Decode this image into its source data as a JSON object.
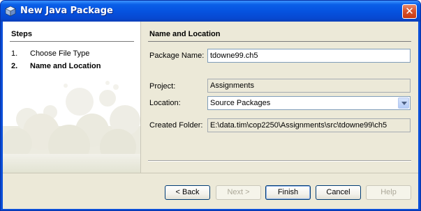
{
  "window": {
    "title": "New Java Package",
    "close_glyph": "✕"
  },
  "steps": {
    "title": "Steps",
    "items": [
      {
        "num": "1.",
        "label": "Choose File Type",
        "active": false
      },
      {
        "num": "2.",
        "label": "Name and Location",
        "active": true
      }
    ]
  },
  "form": {
    "title": "Name and Location",
    "package_name": {
      "label": "Package Name:",
      "value": "tdowne99.ch5"
    },
    "project": {
      "label": "Project:",
      "value": "Assignments"
    },
    "location": {
      "label": "Location:",
      "value": "Source Packages"
    },
    "created_folder": {
      "label": "Created Folder:",
      "value": "E:\\data.tim\\cop2250\\Assignments\\src\\tdowne99\\ch5"
    }
  },
  "buttons": {
    "back": "< Back",
    "next": "Next >",
    "finish": "Finish",
    "cancel": "Cancel",
    "help": "Help"
  },
  "colors": {
    "title_bar": "#0653e0",
    "client_bg": "#ece9d8",
    "close_button": "#d8532c"
  }
}
